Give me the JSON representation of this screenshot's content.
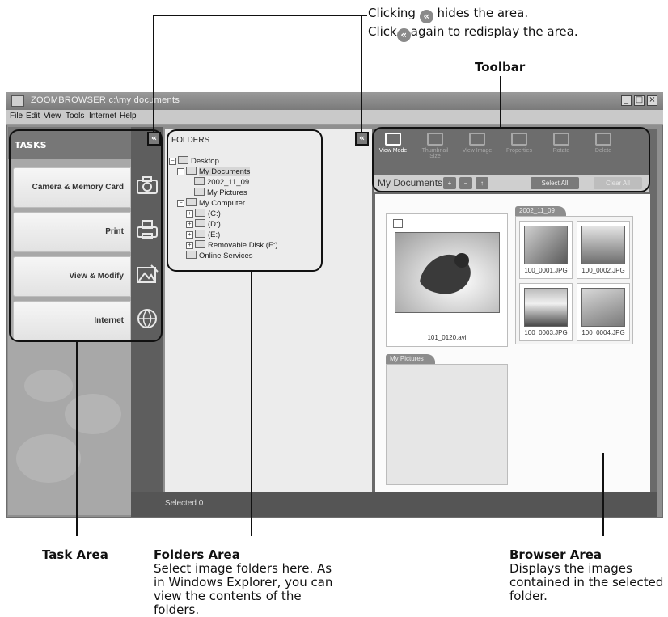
{
  "callouts": {
    "collapse_line1_before": "Clicking",
    "collapse_line1_after": "hides the area.",
    "collapse_line2_before": "Click",
    "collapse_line2_after": "again to redisplay the area.",
    "toolbar": "Toolbar",
    "task_area": "Task Area",
    "folders_area": "Folders Area",
    "folders_area_desc": "Select image folders here. As in Windows Explorer, you can view the contents of the folders.",
    "browser_area": "Browser Area",
    "browser_area_desc": "Displays the images contained in the selected folder."
  },
  "window": {
    "title": "ZOOMBROWSER c:\\my documents",
    "menu": [
      "File",
      "Edit",
      "View",
      "Tools",
      "Internet",
      "Help"
    ]
  },
  "tasks": {
    "header": "TASKS",
    "items": [
      {
        "label": "Camera & Memory Card",
        "icon": "camera-icon"
      },
      {
        "label": "Print",
        "icon": "printer-icon"
      },
      {
        "label": "View & Modify",
        "icon": "image-edit-icon"
      },
      {
        "label": "Internet",
        "icon": "globe-mail-icon"
      }
    ]
  },
  "folders": {
    "header": "FOLDERS",
    "tree": [
      {
        "label": "Desktop",
        "level": 0,
        "toggle": "−"
      },
      {
        "label": "My Documents",
        "level": 1,
        "toggle": "−",
        "selected": true
      },
      {
        "label": "2002_11_09",
        "level": 2,
        "toggle": ""
      },
      {
        "label": "My Pictures",
        "level": 2,
        "toggle": ""
      },
      {
        "label": "My Computer",
        "level": 1,
        "toggle": "−"
      },
      {
        "label": "(C:)",
        "level": 2,
        "toggle": "+"
      },
      {
        "label": "(D:)",
        "level": 2,
        "toggle": "+"
      },
      {
        "label": "(E:)",
        "level": 2,
        "toggle": "+"
      },
      {
        "label": "Removable Disk (F:)",
        "level": 2,
        "toggle": "+"
      },
      {
        "label": "Online Services",
        "level": 1,
        "toggle": ""
      }
    ]
  },
  "toolbar": {
    "buttons": [
      {
        "label": "View Mode",
        "icon": "view-mode-icon",
        "active": true
      },
      {
        "label": "Thumbnail Size",
        "icon": "thumbnail-size-icon",
        "active": false
      },
      {
        "label": "View Image",
        "icon": "view-image-icon",
        "active": false
      },
      {
        "label": "Properties",
        "icon": "properties-icon",
        "active": false
      },
      {
        "label": "Rotate",
        "icon": "rotate-icon",
        "active": false
      },
      {
        "label": "Delete",
        "icon": "delete-icon",
        "active": false
      }
    ],
    "path": "My Documents",
    "select_all": "Select All",
    "clear_all": "Clear All"
  },
  "browser": {
    "video_caption": "101_0120.avi",
    "group_2002": "2002_11_09",
    "thumbs": [
      "100_0001.JPG",
      "100_0002.JPG",
      "100_0003.JPG",
      "100_0004.JPG"
    ],
    "group_pictures": "My Pictures"
  },
  "status": {
    "selected": "Selected  0"
  }
}
